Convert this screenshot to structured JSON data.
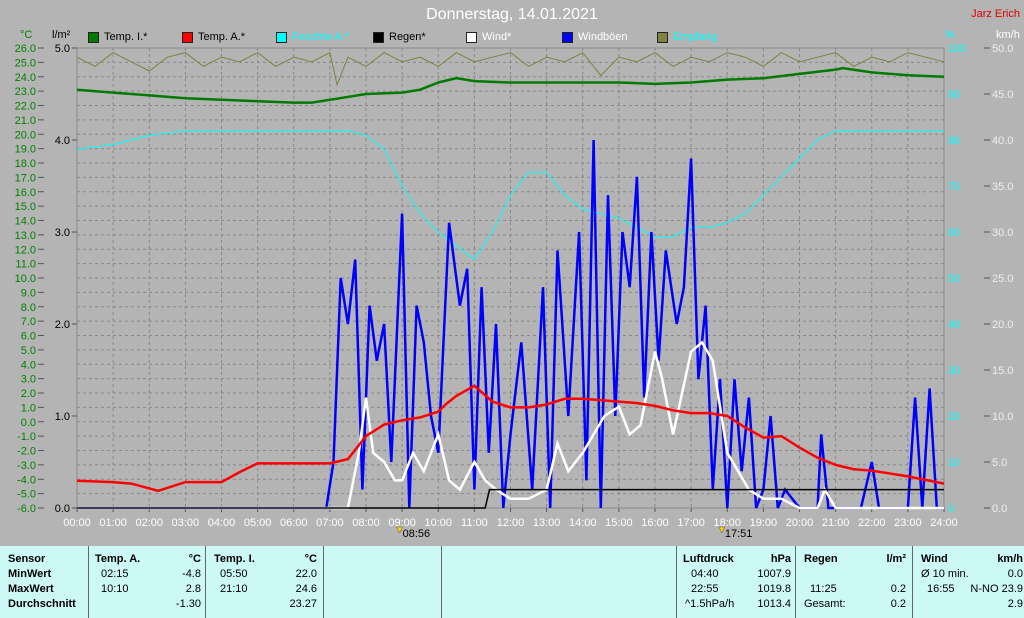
{
  "header": {
    "title": "Donnerstag, 14.01.2021",
    "author": "Jarz Erich"
  },
  "legend": [
    {
      "label": "Temp. I.*",
      "color": "#007a00",
      "text_color": "#000000"
    },
    {
      "label": "Temp. A.*",
      "color": "#ff0000",
      "text_color": "#000000"
    },
    {
      "label": "Feuchte A.*",
      "color": "#00ffff",
      "text_color": "#00ffff"
    },
    {
      "label": "Regen*",
      "color": "#000000",
      "text_color": "#000000"
    },
    {
      "label": "Wind*",
      "color": "#ffffff",
      "text_color": "#ffffff"
    },
    {
      "label": "Windböen",
      "color": "#0000ff",
      "text_color": "#ffffff"
    },
    {
      "label": "Empfang",
      "color": "#808040",
      "text_color": "#00ffff"
    }
  ],
  "chart_data": {
    "type": "line",
    "title": "Donnerstag, 14.01.2021",
    "axes": {
      "temp": {
        "unit": "°C",
        "range": [
          -6,
          26
        ],
        "ticks": [
          "26.0",
          "25.0",
          "24.0",
          "23.0",
          "22.0",
          "21.0",
          "20.0",
          "19.0",
          "18.0",
          "17.0",
          "16.0",
          "15.0",
          "14.0",
          "13.0",
          "12.0",
          "11.0",
          "10.0",
          "9.0",
          "8.0",
          "7.0",
          "6.0",
          "5.0",
          "4.0",
          "3.0",
          "2.0",
          "1.0",
          "0.0",
          "-1.0",
          "-2.0",
          "-3.0",
          "-4.0",
          "-5.0",
          "-6.0"
        ]
      },
      "rain": {
        "unit": "l/m²",
        "range": [
          0,
          5
        ],
        "ticks": [
          "5.0",
          "4.0",
          "3.0",
          "2.0",
          "1.0",
          "0.0"
        ]
      },
      "humidity": {
        "unit": "%",
        "range": [
          0,
          100
        ],
        "ticks": [
          "100",
          "90",
          "80",
          "70",
          "60",
          "50",
          "40",
          "30",
          "20",
          "10",
          "0"
        ]
      },
      "wind": {
        "unit": "km/h",
        "range": [
          0,
          50
        ],
        "ticks": [
          "50.0",
          "45.0",
          "40.0",
          "35.0",
          "30.0",
          "25.0",
          "20.0",
          "15.0",
          "10.0",
          "5.0",
          "0.0"
        ]
      },
      "x": {
        "range": [
          0,
          24
        ],
        "ticks": [
          "00:00",
          "01:00",
          "02:00",
          "03:00",
          "04:00",
          "05:00",
          "06:00",
          "07:00",
          "08:00",
          "09:00",
          "10:00",
          "11:00",
          "12:00",
          "13:00",
          "14:00",
          "15:00",
          "16:00",
          "17:00",
          "18:00",
          "19:00",
          "20:00",
          "21:00",
          "22:00",
          "23:00",
          "24:00"
        ]
      }
    },
    "markers": [
      {
        "label": "08:56",
        "hour": 8.93,
        "kind": "sunrise"
      },
      {
        "label": "17:51",
        "hour": 17.85,
        "kind": "sunset"
      }
    ],
    "series": [
      {
        "name": "Temp. I.*",
        "axis": "temp",
        "color": "#007a00",
        "x": [
          0,
          1,
          2,
          3,
          4,
          5,
          6,
          6.5,
          7,
          8,
          9,
          9.5,
          10,
          10.5,
          11,
          12,
          13,
          14,
          15,
          16,
          17,
          18,
          19,
          20,
          21,
          21.2,
          22,
          23,
          24
        ],
        "y": [
          23.1,
          22.9,
          22.7,
          22.5,
          22.4,
          22.3,
          22.2,
          22.2,
          22.4,
          22.8,
          22.9,
          23.1,
          23.6,
          23.9,
          23.7,
          23.6,
          23.6,
          23.6,
          23.6,
          23.5,
          23.6,
          23.8,
          23.9,
          24.2,
          24.5,
          24.6,
          24.3,
          24.1,
          24.0
        ]
      },
      {
        "name": "Temp. A.*",
        "axis": "temp",
        "color": "#ff0000",
        "x": [
          0,
          1,
          1.5,
          2.25,
          3,
          3.5,
          4,
          4.5,
          5,
          6,
          7,
          7.5,
          8,
          8.5,
          9,
          9.5,
          10,
          10.2,
          10.5,
          11,
          11.5,
          12,
          12.5,
          13,
          13.5,
          14,
          15,
          15.5,
          16,
          16.5,
          17,
          17.5,
          18,
          18.5,
          19,
          19.5,
          20,
          20.5,
          21,
          21.5,
          22,
          23,
          24
        ],
        "y": [
          -4.1,
          -4.2,
          -4.3,
          -4.8,
          -4.2,
          -4.2,
          -4.2,
          -3.5,
          -2.9,
          -2.9,
          -2.9,
          -2.6,
          -1.0,
          -0.2,
          0.1,
          0.3,
          0.7,
          1.2,
          1.8,
          2.5,
          1.4,
          1.0,
          1.0,
          1.2,
          1.6,
          1.6,
          1.4,
          1.3,
          1.1,
          0.8,
          0.6,
          0.6,
          0.4,
          -0.4,
          -1.1,
          -1.0,
          -1.8,
          -2.5,
          -3.0,
          -3.3,
          -3.4,
          -3.8,
          -4.3
        ]
      },
      {
        "name": "Feuchte A.*",
        "axis": "humidity",
        "color": "#00ffff",
        "x": [
          0,
          1,
          2,
          3,
          4,
          5,
          6,
          7,
          7.5,
          8,
          8.5,
          9,
          9.5,
          10,
          10.5,
          11,
          11.5,
          12,
          12.5,
          13,
          13.5,
          14,
          15,
          16,
          16.5,
          17,
          17.5,
          18,
          18.5,
          19,
          19.5,
          20,
          20.5,
          21,
          22,
          23,
          24
        ],
        "y": [
          78,
          79,
          81,
          82,
          82,
          82,
          82,
          82,
          82,
          81,
          78,
          70,
          64,
          60,
          57,
          54,
          60,
          68,
          73,
          73,
          68,
          65,
          63,
          59,
          59,
          61,
          61,
          62,
          64,
          68,
          72,
          76,
          80,
          82,
          82,
          82,
          82
        ]
      },
      {
        "name": "Regen*",
        "axis": "rain",
        "color": "#000000",
        "x": [
          0,
          11.3,
          11.42,
          24
        ],
        "y": [
          0,
          0,
          0.2,
          0.2
        ]
      },
      {
        "name": "Wind*",
        "axis": "wind",
        "color": "#ffffff",
        "x": [
          0,
          7.5,
          7.8,
          8,
          8.2,
          8.5,
          8.8,
          9,
          9.3,
          9.6,
          10,
          10.3,
          10.6,
          11,
          11.3,
          11.6,
          12,
          12.5,
          13,
          13.3,
          13.6,
          14,
          14.3,
          14.6,
          15,
          15.3,
          15.6,
          16,
          16.2,
          16.5,
          17,
          17.3,
          17.6,
          18,
          18.3,
          18.6,
          19,
          19.5,
          20,
          20.5,
          20.7,
          21,
          24
        ],
        "y": [
          0,
          0,
          6,
          12,
          6,
          5,
          3,
          3,
          6,
          4,
          8,
          3,
          2,
          5,
          3,
          2,
          1,
          1,
          2,
          7,
          4,
          6,
          8,
          10,
          11,
          8,
          9,
          17,
          14,
          8,
          17,
          18,
          16,
          6,
          4,
          2,
          1,
          1,
          0,
          0,
          2,
          0,
          0
        ]
      },
      {
        "name": "Windböen",
        "axis": "wind",
        "color": "#0000ff",
        "x": [
          0,
          6.9,
          7.1,
          7.3,
          7.5,
          7.7,
          7.9,
          8.1,
          8.3,
          8.5,
          8.7,
          9,
          9.2,
          9.4,
          9.6,
          9.8,
          10,
          10.3,
          10.6,
          10.8,
          11,
          11.2,
          11.4,
          11.6,
          11.8,
          12,
          12.3,
          12.6,
          12.9,
          13.1,
          13.3,
          13.6,
          13.9,
          14.1,
          14.3,
          14.5,
          14.7,
          14.9,
          15.1,
          15.3,
          15.5,
          15.7,
          15.9,
          16.1,
          16.3,
          16.6,
          16.8,
          17,
          17.2,
          17.4,
          17.6,
          17.8,
          18,
          18.2,
          18.4,
          18.6,
          18.8,
          19,
          19.2,
          19.4,
          19.6,
          20,
          20.5,
          20.6,
          20.8,
          21,
          21.7,
          22,
          22.2,
          22.5,
          23,
          23.2,
          23.4,
          23.6,
          23.8,
          24
        ],
        "y": [
          0,
          0,
          5,
          25,
          20,
          27,
          2,
          22,
          16,
          20,
          5,
          32,
          0,
          22,
          18,
          10,
          6,
          31,
          22,
          26,
          2,
          24,
          6,
          20,
          0,
          8,
          18,
          2,
          24,
          0,
          28,
          10,
          30,
          3,
          40,
          0,
          34,
          10,
          30,
          24,
          36,
          12,
          30,
          16,
          28,
          20,
          24,
          38,
          14,
          22,
          2,
          14,
          0,
          14,
          4,
          12,
          0,
          2,
          10,
          0,
          2,
          0,
          0,
          8,
          0,
          0,
          0,
          5,
          0,
          0,
          0,
          12,
          0,
          13,
          0,
          0
        ]
      },
      {
        "name": "Empfang",
        "axis": "humidity",
        "color": "#808040",
        "x": [
          0,
          0.5,
          1,
          1.5,
          2,
          2.5,
          3,
          3.5,
          4,
          4.5,
          5,
          5.5,
          6,
          6.5,
          7,
          7.2,
          7.5,
          8,
          8.5,
          9,
          9.5,
          10,
          10.5,
          11,
          11.5,
          12,
          12.5,
          13,
          13.5,
          14,
          14.5,
          15,
          15.5,
          16,
          16.5,
          17,
          17.5,
          18,
          18.5,
          19,
          19.5,
          20,
          20.5,
          21,
          21.5,
          22,
          22.5,
          23,
          23.5,
          24
        ],
        "y": [
          98,
          96,
          99,
          97,
          95,
          98,
          99,
          96,
          98,
          97,
          99,
          96,
          98,
          97,
          99,
          92,
          98,
          96,
          99,
          97,
          98,
          96,
          99,
          97,
          98,
          99,
          96,
          98,
          97,
          99,
          94,
          98,
          97,
          99,
          96,
          98,
          97,
          99,
          98,
          96,
          99,
          97,
          98,
          99,
          96,
          98,
          97,
          99,
          98,
          97
        ]
      }
    ]
  },
  "table": {
    "sensor": {
      "header": "Sensor",
      "rows": [
        "MinWert",
        "MaxWert",
        "Durchschnitt"
      ]
    },
    "temp_a": {
      "header": "Temp. A.",
      "unit": "°C",
      "min_time": "02:15",
      "min": "-4.8",
      "max_time": "10:10",
      "max": "2.8",
      "avg": "-1.30"
    },
    "temp_i": {
      "header": "Temp. I.",
      "unit": "°C",
      "min_time": "05:50",
      "min": "22.0",
      "max_time": "21:10",
      "max": "24.6",
      "avg": "23.27"
    },
    "pressure": {
      "header": "Luftdruck",
      "unit": "hPa",
      "min_time": "04:40",
      "min": "1007.9",
      "max_time": "22:55",
      "max": "1019.8",
      "trend": "^1.5hPa/h",
      "avg": "1013.4"
    },
    "rain": {
      "header": "Regen",
      "unit": "l/m²",
      "max_time": "11:25",
      "max": "0.2",
      "total_label": "Gesamt:",
      "total": "0.2"
    },
    "wind": {
      "header": "Wind",
      "unit": "km/h",
      "avg10_label": "Ø 10 min.",
      "avg10": "0.0",
      "max_time": "16:55",
      "max": "N-NO 23.9",
      "avg": "2.9"
    }
  }
}
